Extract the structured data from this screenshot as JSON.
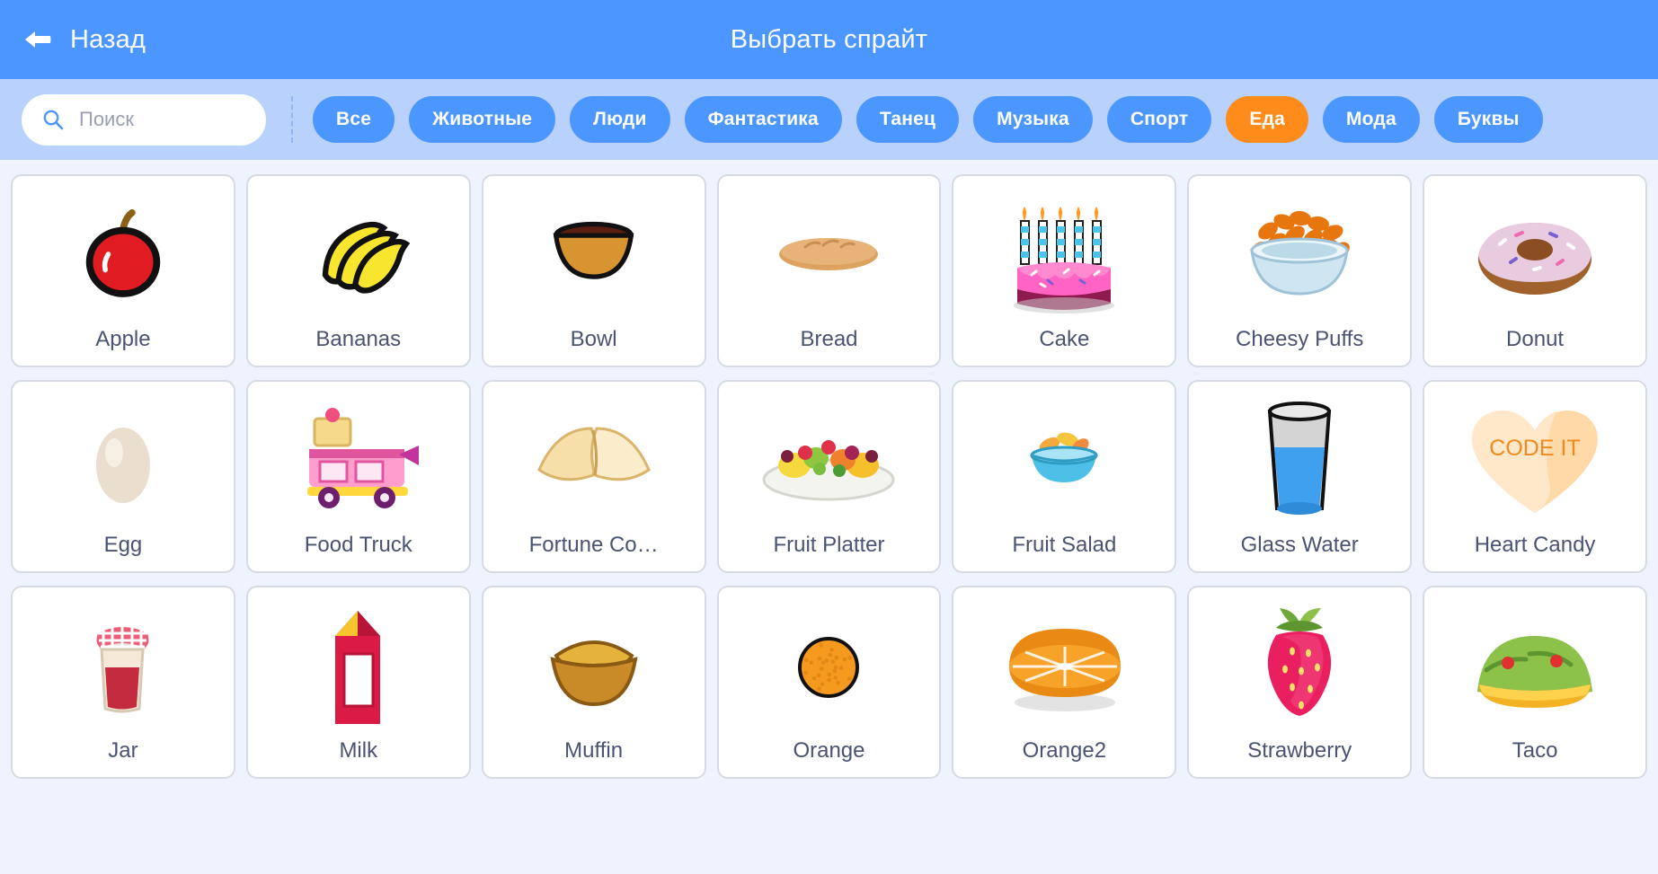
{
  "header": {
    "back_label": "Назад",
    "back_icon": "arrow-left-icon",
    "title": "Выбрать спрайт",
    "bg_color": "#4c97ff"
  },
  "search": {
    "icon": "search-icon",
    "placeholder": "Поиск",
    "value": ""
  },
  "filterbar": {
    "bg_color": "#b8d2fd",
    "active_tab_color": "#ff8c1a",
    "tab_color": "#4c97ff",
    "tabs": [
      {
        "label": "Все",
        "active": false
      },
      {
        "label": "Животные",
        "active": false
      },
      {
        "label": "Люди",
        "active": false
      },
      {
        "label": "Фантастика",
        "active": false
      },
      {
        "label": "Танец",
        "active": false
      },
      {
        "label": "Музыка",
        "active": false
      },
      {
        "label": "Спорт",
        "active": false
      },
      {
        "label": "Еда",
        "active": true
      },
      {
        "label": "Мода",
        "active": false
      },
      {
        "label": "Буквы",
        "active": false
      }
    ]
  },
  "grid": {
    "columns": 7,
    "sprites": [
      {
        "label": "Apple",
        "icon": "apple-sprite"
      },
      {
        "label": "Bananas",
        "icon": "bananas-sprite"
      },
      {
        "label": "Bowl",
        "icon": "bowl-sprite"
      },
      {
        "label": "Bread",
        "icon": "bread-sprite"
      },
      {
        "label": "Cake",
        "icon": "cake-sprite"
      },
      {
        "label": "Cheesy Puffs",
        "icon": "cheesy-puffs-sprite"
      },
      {
        "label": "Donut",
        "icon": "donut-sprite"
      },
      {
        "label": "Egg",
        "icon": "egg-sprite"
      },
      {
        "label": "Food Truck",
        "icon": "food-truck-sprite"
      },
      {
        "label": "Fortune Co…",
        "icon": "fortune-cookie-sprite"
      },
      {
        "label": "Fruit Platter",
        "icon": "fruit-platter-sprite"
      },
      {
        "label": "Fruit Salad",
        "icon": "fruit-salad-sprite"
      },
      {
        "label": "Glass Water",
        "icon": "glass-water-sprite"
      },
      {
        "label": "Heart Candy",
        "icon": "heart-candy-sprite",
        "candy_text": "CODE IT"
      },
      {
        "label": "Jar",
        "icon": "jar-sprite"
      },
      {
        "label": "Milk",
        "icon": "milk-sprite"
      },
      {
        "label": "Muffin",
        "icon": "muffin-sprite"
      },
      {
        "label": "Orange",
        "icon": "orange-sprite"
      },
      {
        "label": "Orange2",
        "icon": "orange2-sprite"
      },
      {
        "label": "Strawberry",
        "icon": "strawberry-sprite"
      },
      {
        "label": "Taco",
        "icon": "taco-sprite"
      }
    ]
  }
}
